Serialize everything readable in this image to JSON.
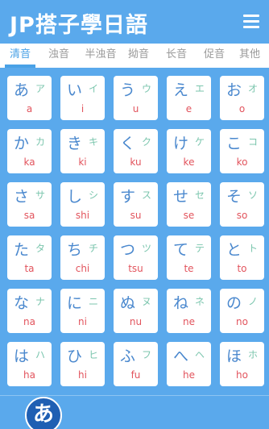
{
  "header": {
    "title": "JP搭子學日語",
    "menu_icon": "hamburger-menu-icon"
  },
  "tabs": [
    {
      "label": "清音",
      "active": true
    },
    {
      "label": "浊音",
      "active": false
    },
    {
      "label": "半浊音",
      "active": false
    },
    {
      "label": "拗音",
      "active": false
    },
    {
      "label": "长音",
      "active": false
    },
    {
      "label": "促音",
      "active": false
    },
    {
      "label": "其他",
      "active": false
    }
  ],
  "kana": [
    {
      "hira": "あ",
      "kata": "ア",
      "roma": "a"
    },
    {
      "hira": "い",
      "kata": "イ",
      "roma": "i"
    },
    {
      "hira": "う",
      "kata": "ウ",
      "roma": "u"
    },
    {
      "hira": "え",
      "kata": "エ",
      "roma": "e"
    },
    {
      "hira": "お",
      "kata": "オ",
      "roma": "o"
    },
    {
      "hira": "か",
      "kata": "カ",
      "roma": "ka"
    },
    {
      "hira": "き",
      "kata": "キ",
      "roma": "ki"
    },
    {
      "hira": "く",
      "kata": "ク",
      "roma": "ku"
    },
    {
      "hira": "け",
      "kata": "ケ",
      "roma": "ke"
    },
    {
      "hira": "こ",
      "kata": "コ",
      "roma": "ko"
    },
    {
      "hira": "さ",
      "kata": "サ",
      "roma": "sa"
    },
    {
      "hira": "し",
      "kata": "シ",
      "roma": "shi"
    },
    {
      "hira": "す",
      "kata": "ス",
      "roma": "su"
    },
    {
      "hira": "せ",
      "kata": "セ",
      "roma": "se"
    },
    {
      "hira": "そ",
      "kata": "ソ",
      "roma": "so"
    },
    {
      "hira": "た",
      "kata": "タ",
      "roma": "ta"
    },
    {
      "hira": "ち",
      "kata": "チ",
      "roma": "chi"
    },
    {
      "hira": "つ",
      "kata": "ツ",
      "roma": "tsu"
    },
    {
      "hira": "て",
      "kata": "テ",
      "roma": "te"
    },
    {
      "hira": "と",
      "kata": "ト",
      "roma": "to"
    },
    {
      "hira": "な",
      "kata": "ナ",
      "roma": "na"
    },
    {
      "hira": "に",
      "kata": "ニ",
      "roma": "ni"
    },
    {
      "hira": "ぬ",
      "kata": "ヌ",
      "roma": "nu"
    },
    {
      "hira": "ね",
      "kata": "ネ",
      "roma": "ne"
    },
    {
      "hira": "の",
      "kata": "ノ",
      "roma": "no"
    },
    {
      "hira": "は",
      "kata": "ハ",
      "roma": "ha"
    },
    {
      "hira": "ひ",
      "kata": "ヒ",
      "roma": "hi"
    },
    {
      "hira": "ふ",
      "kata": "フ",
      "roma": "fu"
    },
    {
      "hira": "へ",
      "kata": "ヘ",
      "roma": "he"
    },
    {
      "hira": "ほ",
      "kata": "ホ",
      "roma": "ho"
    }
  ],
  "fab": {
    "label": "あ"
  },
  "colors": {
    "primary": "#5aa9ec",
    "tab_active": "#4aa1e6",
    "hiragana": "#4a88ce",
    "katakana": "#7cc6ae",
    "romaji": "#e2545d",
    "fab": "#1f5fb3"
  }
}
